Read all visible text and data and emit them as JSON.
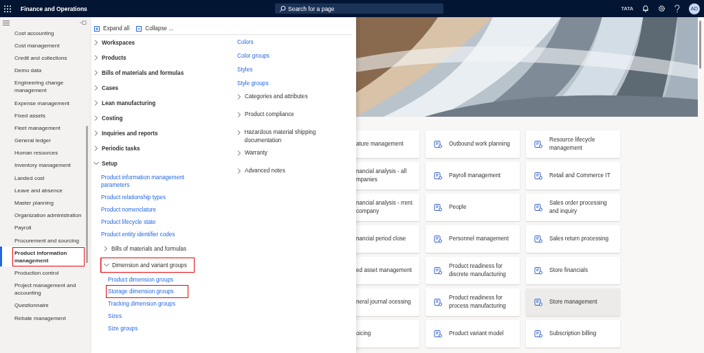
{
  "top_bar": {
    "app_title": "Finance and Operations",
    "search": {
      "placeholder": "Search for a page"
    },
    "company": "TATA",
    "avatar": "AD"
  },
  "nav": {
    "items": [
      {
        "label": "Cost accounting",
        "selected": false,
        "highlighted": false
      },
      {
        "label": "Cost management",
        "selected": false,
        "highlighted": false
      },
      {
        "label": "Credit and collections",
        "selected": false,
        "highlighted": false
      },
      {
        "label": "Demo data",
        "selected": false,
        "highlighted": false
      },
      {
        "label": "Engineering change management",
        "selected": false,
        "highlighted": false
      },
      {
        "label": "Expense management",
        "selected": false,
        "highlighted": false
      },
      {
        "label": "Fixed assets",
        "selected": false,
        "highlighted": false
      },
      {
        "label": "Fleet management",
        "selected": false,
        "highlighted": false
      },
      {
        "label": "General ledger",
        "selected": false,
        "highlighted": false
      },
      {
        "label": "Human resources",
        "selected": false,
        "highlighted": false
      },
      {
        "label": "Inventory management",
        "selected": false,
        "highlighted": false
      },
      {
        "label": "Landed cost",
        "selected": false,
        "highlighted": false
      },
      {
        "label": "Leave and absence",
        "selected": false,
        "highlighted": false
      },
      {
        "label": "Master planning",
        "selected": false,
        "highlighted": false
      },
      {
        "label": "Organization administration",
        "selected": false,
        "highlighted": false
      },
      {
        "label": "Payroll",
        "selected": false,
        "highlighted": false
      },
      {
        "label": "Procurement and sourcing",
        "selected": false,
        "highlighted": false
      },
      {
        "label": "Product information management",
        "selected": true,
        "highlighted": true
      },
      {
        "label": "Production control",
        "selected": false,
        "highlighted": false
      },
      {
        "label": "Project management and accounting",
        "selected": false,
        "highlighted": false
      },
      {
        "label": "Questionnaire",
        "selected": false,
        "highlighted": false
      },
      {
        "label": "Rebate management",
        "selected": false,
        "highlighted": false
      }
    ]
  },
  "flyout": {
    "expand_all": "Expand all",
    "collapse_all": "Collapse ...",
    "column_1": [
      {
        "kind": "group",
        "label": "Workspaces",
        "expanded": false,
        "highlighted": false
      },
      {
        "kind": "group",
        "label": "Products",
        "expanded": false,
        "highlighted": false
      },
      {
        "kind": "group",
        "label": "Bills of materials and formulas",
        "expanded": false,
        "highlighted": false
      },
      {
        "kind": "group",
        "label": "Cases",
        "expanded": false,
        "highlighted": false
      },
      {
        "kind": "group",
        "label": "Lean manufacturing",
        "expanded": false,
        "highlighted": false
      },
      {
        "kind": "group",
        "label": "Costing",
        "expanded": false,
        "highlighted": false
      },
      {
        "kind": "group",
        "label": "Inquiries and reports",
        "expanded": false,
        "highlighted": false
      },
      {
        "kind": "group",
        "label": "Periodic tasks",
        "expanded": false,
        "highlighted": false
      },
      {
        "kind": "group",
        "label": "Setup",
        "expanded": true,
        "highlighted": false,
        "children": [
          {
            "kind": "link",
            "label": "Product information management parameters",
            "highlighted": false
          },
          {
            "kind": "link",
            "label": "Product relationship types",
            "highlighted": false
          },
          {
            "kind": "link",
            "label": "Product nomenclature",
            "highlighted": false
          },
          {
            "kind": "link",
            "label": "Product lifecycle state",
            "highlighted": false
          },
          {
            "kind": "link",
            "label": "Product entity identifier codes",
            "highlighted": false
          },
          {
            "kind": "group",
            "label": "Bills of materials and formulas",
            "expanded": false,
            "highlighted": false
          },
          {
            "kind": "group",
            "label": "Dimension and variant groups",
            "expanded": true,
            "highlighted": true,
            "children": [
              {
                "kind": "link",
                "label": "Product dimension groups",
                "highlighted": false
              },
              {
                "kind": "link",
                "label": "Storage dimension groups",
                "highlighted": true
              },
              {
                "kind": "link",
                "label": "Tracking dimension groups",
                "highlighted": false
              },
              {
                "kind": "link",
                "label": "Sizes",
                "highlighted": false
              },
              {
                "kind": "link",
                "label": "Size groups",
                "highlighted": false
              }
            ]
          }
        ]
      }
    ],
    "column_2": [
      {
        "kind": "link",
        "label": "Colors",
        "highlighted": false
      },
      {
        "kind": "link",
        "label": "Color groups",
        "highlighted": false
      },
      {
        "kind": "link",
        "label": "Styles",
        "highlighted": false
      },
      {
        "kind": "link",
        "label": "Style groups",
        "highlighted": false
      },
      {
        "kind": "group",
        "label": "Categories and attributes",
        "expanded": false,
        "highlighted": false
      },
      {
        "kind": "group",
        "label": "Product compliance",
        "expanded": false,
        "highlighted": false
      },
      {
        "kind": "group",
        "label": "Hazardous material shipping documentation",
        "expanded": false,
        "highlighted": false
      },
      {
        "kind": "group",
        "label": "Warranty",
        "expanded": false,
        "highlighted": false
      },
      {
        "kind": "group",
        "label": "Advanced notes",
        "expanded": false,
        "highlighted": false
      }
    ]
  },
  "tiles": [
    {
      "label": "ature management",
      "partial": true,
      "selected": false
    },
    {
      "label": "Outbound work planning",
      "partial": false,
      "selected": false
    },
    {
      "label": "Resource lifecycle management",
      "partial": false,
      "selected": false
    },
    {
      "label": "nancial analysis - all mpanies",
      "partial": true,
      "selected": false
    },
    {
      "label": "Payroll management",
      "partial": false,
      "selected": false
    },
    {
      "label": "Retail and Commerce IT",
      "partial": false,
      "selected": false
    },
    {
      "label": "nancial analysis - rrent company",
      "partial": true,
      "selected": false
    },
    {
      "label": "People",
      "partial": false,
      "selected": false
    },
    {
      "label": "Sales order processing and inquiry",
      "partial": false,
      "selected": false
    },
    {
      "label": "nancial period close",
      "partial": true,
      "selected": false
    },
    {
      "label": "Personnel management",
      "partial": false,
      "selected": false
    },
    {
      "label": "Sales return processing",
      "partial": false,
      "selected": false
    },
    {
      "label": "ed asset management",
      "partial": true,
      "selected": false
    },
    {
      "label": "Product readiness for discrete manufacturing",
      "partial": false,
      "selected": false
    },
    {
      "label": "Store financials",
      "partial": false,
      "selected": false
    },
    {
      "label": "neral journal ocessing",
      "partial": true,
      "selected": false
    },
    {
      "label": "Product readiness for process manufacturing",
      "partial": false,
      "selected": false
    },
    {
      "label": "Store management",
      "partial": false,
      "selected": true
    },
    {
      "label": "oicing",
      "partial": true,
      "selected": false
    },
    {
      "label": "Product variant model",
      "partial": false,
      "selected": false
    },
    {
      "label": "Subscription billing",
      "partial": false,
      "selected": false
    }
  ]
}
